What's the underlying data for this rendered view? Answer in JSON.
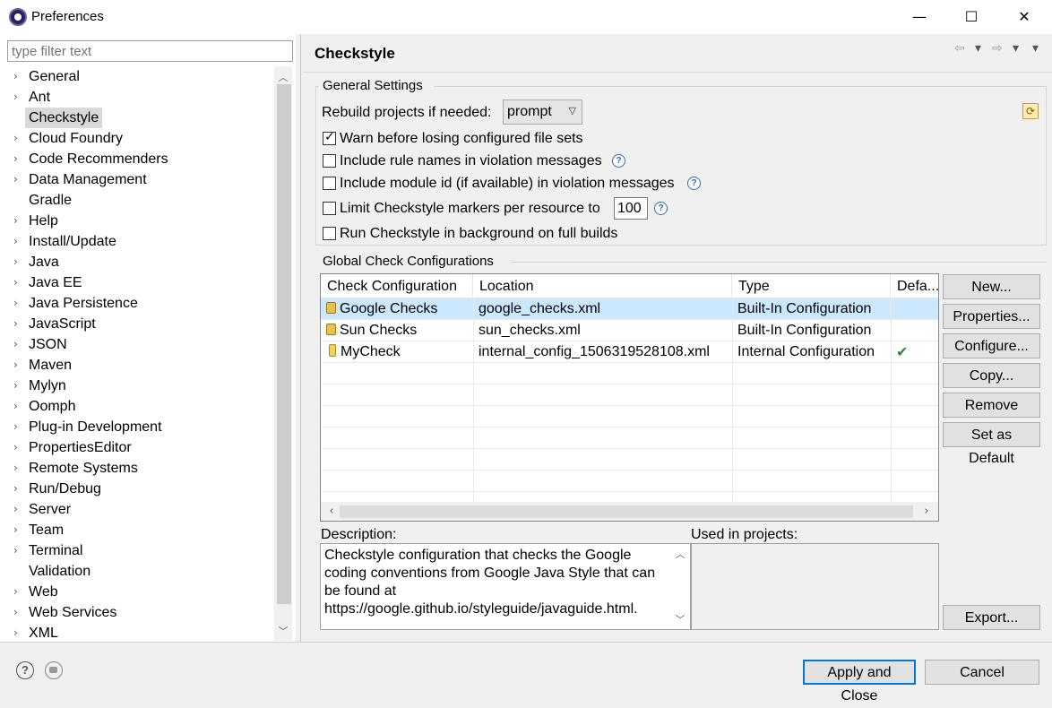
{
  "window": {
    "title": "Preferences",
    "minimize": "—",
    "maximize": "☐",
    "close": "✕"
  },
  "filter": {
    "placeholder": "type filter text"
  },
  "tree": {
    "items": [
      {
        "label": "General",
        "expandable": true
      },
      {
        "label": "Ant",
        "expandable": true
      },
      {
        "label": "Checkstyle",
        "expandable": false,
        "selected": true
      },
      {
        "label": "Cloud Foundry",
        "expandable": true
      },
      {
        "label": "Code Recommenders",
        "expandable": true
      },
      {
        "label": "Data Management",
        "expandable": true
      },
      {
        "label": "Gradle",
        "expandable": false
      },
      {
        "label": "Help",
        "expandable": true
      },
      {
        "label": "Install/Update",
        "expandable": true
      },
      {
        "label": "Java",
        "expandable": true
      },
      {
        "label": "Java EE",
        "expandable": true
      },
      {
        "label": "Java Persistence",
        "expandable": true
      },
      {
        "label": "JavaScript",
        "expandable": true
      },
      {
        "label": "JSON",
        "expandable": true
      },
      {
        "label": "Maven",
        "expandable": true
      },
      {
        "label": "Mylyn",
        "expandable": true
      },
      {
        "label": "Oomph",
        "expandable": true
      },
      {
        "label": "Plug-in Development",
        "expandable": true
      },
      {
        "label": "PropertiesEditor",
        "expandable": true
      },
      {
        "label": "Remote Systems",
        "expandable": true
      },
      {
        "label": "Run/Debug",
        "expandable": true
      },
      {
        "label": "Server",
        "expandable": true
      },
      {
        "label": "Team",
        "expandable": true
      },
      {
        "label": "Terminal",
        "expandable": true
      },
      {
        "label": "Validation",
        "expandable": false
      },
      {
        "label": "Web",
        "expandable": true
      },
      {
        "label": "Web Services",
        "expandable": true
      },
      {
        "label": "XML",
        "expandable": true
      }
    ]
  },
  "page": {
    "title": "Checkstyle",
    "nav": {
      "back": "⇦",
      "forward": "⇨",
      "dropdown": "▾",
      "menu": "▾"
    }
  },
  "general": {
    "label": "General Settings",
    "rebuild_label": "Rebuild projects if needed:",
    "rebuild_value": "prompt",
    "warn_label": "Warn before losing configured file sets",
    "warn_checked": true,
    "rule_names_label": "Include rule names in violation messages",
    "rule_names_checked": false,
    "module_id_label": "Include module id (if available) in violation messages",
    "module_id_checked": false,
    "limit_label": "Limit Checkstyle markers per resource to",
    "limit_checked": false,
    "limit_value": "100",
    "background_label": "Run Checkstyle in background on full builds",
    "background_checked": false,
    "help_glyph": "?"
  },
  "global": {
    "label": "Global Check Configurations",
    "columns": [
      "Check Configuration",
      "Location",
      "Type",
      "Defa..."
    ],
    "rows": [
      {
        "name": "Google Checks",
        "location": "google_checks.xml",
        "type": "Built-In Configuration",
        "default": "",
        "icon": "lock-icon"
      },
      {
        "name": "Sun Checks",
        "location": "sun_checks.xml",
        "type": "Built-In Configuration",
        "default": "",
        "icon": "lock-icon"
      },
      {
        "name": "MyCheck",
        "location": "internal_config_1506319528108.xml",
        "type": "Internal Configuration",
        "default": "✔",
        "icon": "file-icon"
      }
    ],
    "buttons": {
      "new": "New...",
      "properties": "Properties...",
      "configure": "Configure...",
      "copy": "Copy...",
      "remove": "Remove",
      "set_default": "Set as Default",
      "export": "Export..."
    }
  },
  "description": {
    "label": "Description:",
    "text": "Checkstyle configuration that checks the Google coding conventions from Google Java Style that can be found at https://google.github.io/styleguide/javaguide.html.",
    "projects_label": "Used in projects:"
  },
  "footer": {
    "help": "?",
    "apply_close": "Apply and Close",
    "cancel": "Cancel"
  },
  "colors": {
    "selection": "#cce8ff",
    "primary_border": "#0078d7"
  }
}
